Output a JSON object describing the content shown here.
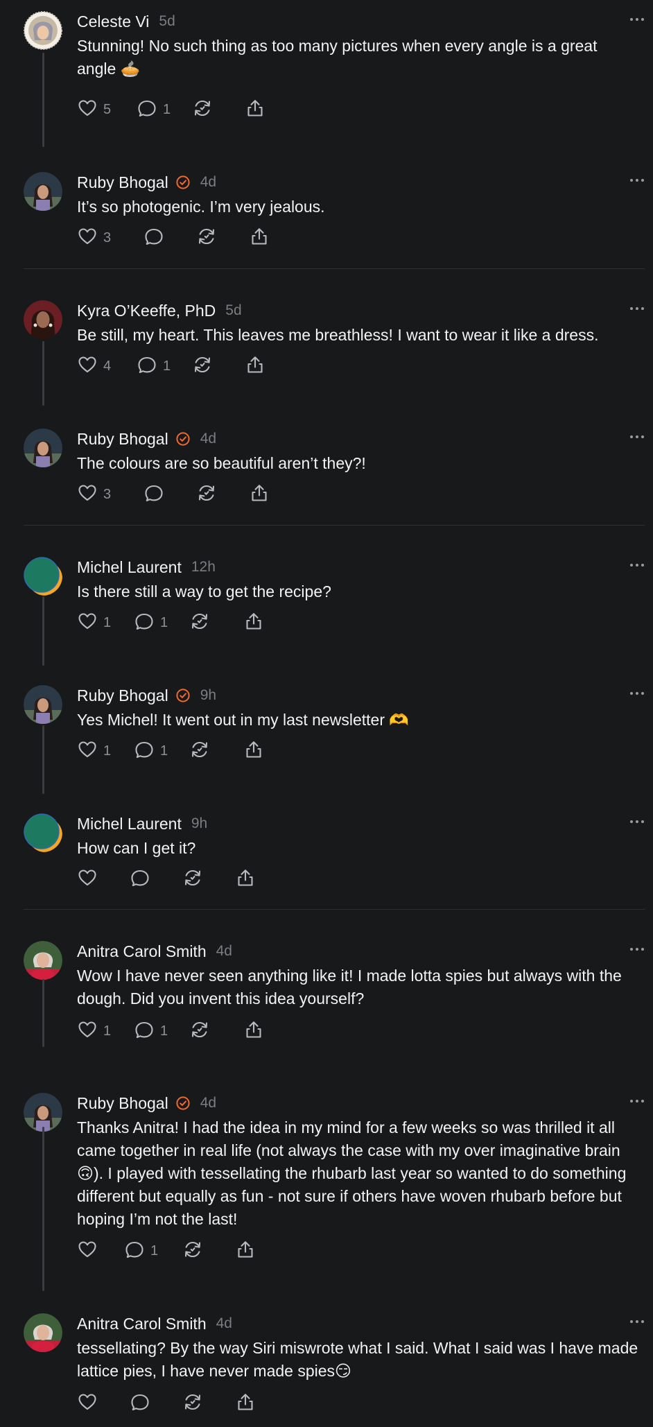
{
  "posts": [
    {
      "name": "Celeste Vi",
      "verified": false,
      "time": "5d",
      "body": "Stunning! No such thing as too many pictures when every angle is a great angle 🥧",
      "likes": "5",
      "replies": "1",
      "avatar": "celeste"
    },
    {
      "name": "Ruby Bhogal",
      "verified": true,
      "time": "4d",
      "body": "It’s so photogenic. I’m very jealous.",
      "likes": "3",
      "replies": "",
      "avatar": "ruby"
    },
    {
      "name": "Kyra O’Keeffe, PhD",
      "verified": false,
      "time": "5d",
      "body": "Be still, my heart. This leaves me breathless! I want to wear it like a dress.",
      "likes": "4",
      "replies": "1",
      "avatar": "kyra"
    },
    {
      "name": "Ruby Bhogal",
      "verified": true,
      "time": "4d",
      "body": "The colours are so beautiful aren’t they?!",
      "likes": "3",
      "replies": "",
      "avatar": "ruby"
    },
    {
      "name": "Michel Laurent",
      "verified": false,
      "time": "12h",
      "body": "Is there still a way to get the recipe?",
      "likes": "1",
      "replies": "1",
      "avatar": "michel"
    },
    {
      "name": "Ruby Bhogal",
      "verified": true,
      "time": "9h",
      "body": "Yes Michel! It went out in my last newsletter 🫶",
      "likes": "1",
      "replies": "1",
      "avatar": "ruby"
    },
    {
      "name": "Michel Laurent",
      "verified": false,
      "time": "9h",
      "body": "How can I get it?",
      "likes": "",
      "replies": "",
      "avatar": "michel"
    },
    {
      "name": "Anitra Carol Smith",
      "verified": false,
      "time": "4d",
      "body": "Wow I have never seen anything like it! I made lotta spies but always with the dough. Did you invent this idea yourself?",
      "likes": "1",
      "replies": "1",
      "avatar": "anitra"
    },
    {
      "name": "Ruby Bhogal",
      "verified": true,
      "time": "4d",
      "body": "Thanks Anitra! I had the idea in my mind for a few weeks so was thrilled it all came together in real life (not always the case with my over imaginative brain 🙃). I played with tessellating the rhubarb last year so wanted to do something different but equally as fun - not sure if others have woven rhubarb before but hoping I’m not the last!",
      "likes": "",
      "replies": "1",
      "avatar": "ruby"
    },
    {
      "name": "Anitra Carol Smith",
      "verified": false,
      "time": "4d",
      "body": "tessellating? By the way Siri miswrote what I said. What I said was I have made lattice pies, I have never made spies😏",
      "likes": "",
      "replies": "",
      "avatar": "anitra"
    }
  ],
  "colors": {
    "background": "#18191b",
    "verified": "#f06a2e",
    "muted": "#7c7d80"
  },
  "icons": [
    "heart-icon",
    "comment-icon",
    "repost-icon",
    "share-icon",
    "more-icon",
    "verified-icon"
  ]
}
